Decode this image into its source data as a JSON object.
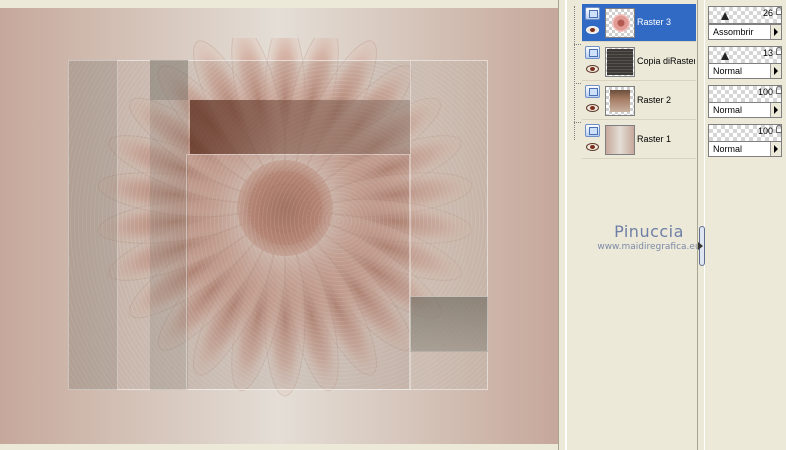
{
  "canvas": {
    "description_colors": {
      "left": "#c6a89b",
      "center": "#e4ded6",
      "flower": "#c08070"
    }
  },
  "layers": [
    {
      "name": "Raster 3",
      "opacity": "26",
      "blend": "Assombrir",
      "selected": true,
      "thumb": "flower-thumbnail"
    },
    {
      "name": "Copia diRaster",
      "opacity": "13",
      "blend": "Normal",
      "selected": false,
      "thumb": "dark-texture-thumbnail"
    },
    {
      "name": "Raster 2",
      "opacity": "100",
      "blend": "Normal",
      "selected": false,
      "thumb": "brown-rect-thumbnail"
    },
    {
      "name": "Raster 1",
      "opacity": "100",
      "blend": "Normal",
      "selected": false,
      "thumb": "gradient-thumbnail"
    }
  ],
  "watermark": {
    "name": "Pinuccia",
    "site": "www.maidiregrafica.eu"
  },
  "colors": {
    "selection": "#316ac5",
    "panel": "#ece9d8"
  }
}
